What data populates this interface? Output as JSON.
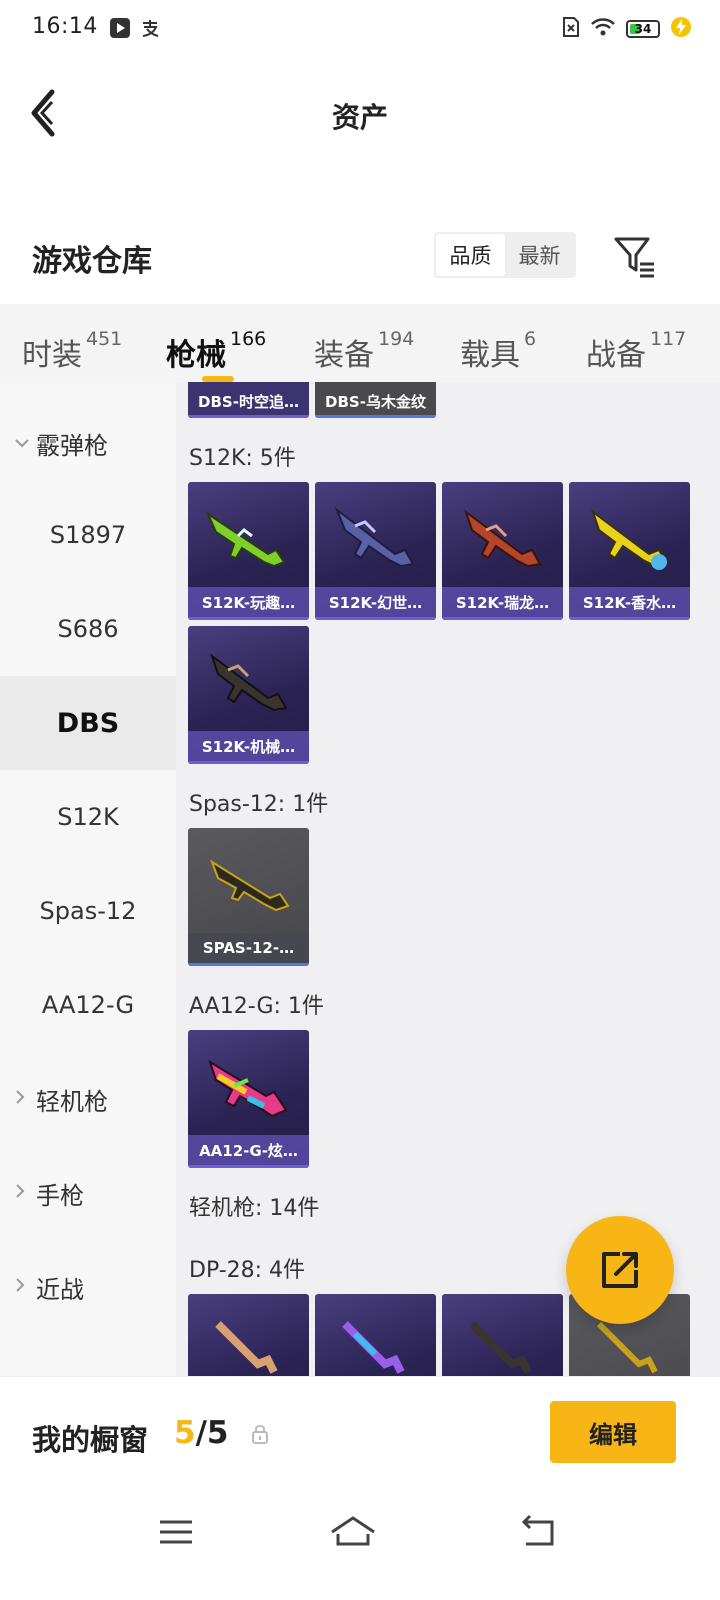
{
  "status_bar": {
    "time": "16:14",
    "battery": "34",
    "icons": [
      "play-icon",
      "alipay-icon",
      "no-sim-icon",
      "wifi-icon",
      "battery-icon",
      "charging-icon"
    ]
  },
  "header": {
    "title": "资产"
  },
  "warehouse": {
    "title": "游戏仓库",
    "sort_options": [
      "品质",
      "最新"
    ],
    "sort_selected": "品质"
  },
  "tabs": [
    {
      "label": "时装",
      "count": "451"
    },
    {
      "label": "枪械",
      "count": "166",
      "active": true
    },
    {
      "label": "装备",
      "count": "194"
    },
    {
      "label": "载具",
      "count": "6"
    },
    {
      "label": "战备",
      "count": "117"
    }
  ],
  "left_nav": [
    {
      "type": "group",
      "label": "霰弹枪",
      "expanded": true
    },
    {
      "type": "sub",
      "label": "S1897"
    },
    {
      "type": "sub",
      "label": "S686"
    },
    {
      "type": "sub",
      "label": "DBS",
      "selected": true
    },
    {
      "type": "sub",
      "label": "S12K"
    },
    {
      "type": "sub",
      "label": "Spas-12"
    },
    {
      "type": "sub",
      "label": "AA12-G"
    },
    {
      "type": "group",
      "label": "轻机枪",
      "expanded": false
    },
    {
      "type": "group",
      "label": "手枪",
      "expanded": false
    },
    {
      "type": "group",
      "label": "近战",
      "expanded": false
    }
  ],
  "content": {
    "partial_top": [
      "DBS-时空追…",
      "DBS-乌木金纹"
    ],
    "sections": [
      {
        "title": "S12K: 5件",
        "items": [
          "S12K-玩趣…",
          "S12K-幻世…",
          "S12K-瑞龙…",
          "S12K-香水…",
          "S12K-机械…"
        ]
      },
      {
        "title": "Spas-12: 1件",
        "items": [
          "SPAS-12-…"
        ]
      },
      {
        "title": "AA12-G: 1件",
        "items": [
          "AA12-G-炫…"
        ]
      },
      {
        "title": "轻机枪: 14件",
        "items": []
      },
      {
        "title": "DP-28: 4件",
        "items": []
      }
    ]
  },
  "showcase": {
    "title": "我的橱窗",
    "current": "5",
    "separator": "/",
    "total": "5",
    "edit_label": "编辑"
  },
  "colors": {
    "accent": "#f7b516",
    "card_purple": "#2b2354",
    "card_gray": "#4a4a4e"
  }
}
